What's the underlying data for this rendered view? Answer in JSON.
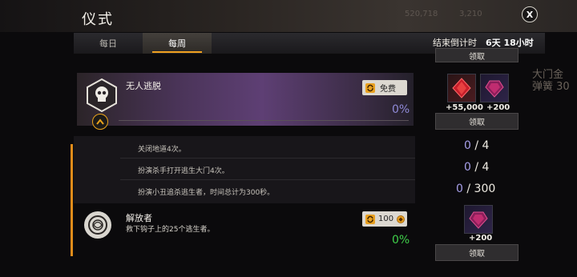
{
  "header": {
    "title": "仪式",
    "close_label": "X",
    "bg_numbers": [
      "520,718",
      "3,210"
    ]
  },
  "tabs": [
    {
      "label": "每日",
      "active": false
    },
    {
      "label": "每周",
      "active": true
    }
  ],
  "countdown": {
    "label": "结束倒计时",
    "value": "6天 18小时"
  },
  "claim_label": "领取",
  "challenge1": {
    "name": "无人逃脱",
    "badge": "免费",
    "progress": "0%",
    "rewards": [
      {
        "icon": "red-shard-icon",
        "label": "+55,000"
      },
      {
        "icon": "purple-gem-icon",
        "label": "+200"
      }
    ],
    "tasks": [
      {
        "text": "关闭地道4次。",
        "current": "0",
        "sep": "/",
        "total": "4"
      },
      {
        "text": "扮演杀手打开逃生大门4次。",
        "current": "0",
        "sep": "/",
        "total": "4"
      },
      {
        "text": "扮演小丑追杀逃生者，时间总计为300秒。",
        "current": "0",
        "sep": "/",
        "total": "300"
      }
    ]
  },
  "challenge2": {
    "name": "解放者",
    "description": "救下钩子上的25个逃生者。",
    "cost": "100",
    "progress": "0%",
    "rewards": [
      {
        "icon": "purple-gem-icon",
        "label": "+200"
      }
    ]
  },
  "background_right": {
    "line1": "大门金",
    "line2": "弹簧 30"
  },
  "colors": {
    "accent": "#e08c1a",
    "progress_purple": "#8f8ad8",
    "progress_green": "#3fcf4a"
  }
}
